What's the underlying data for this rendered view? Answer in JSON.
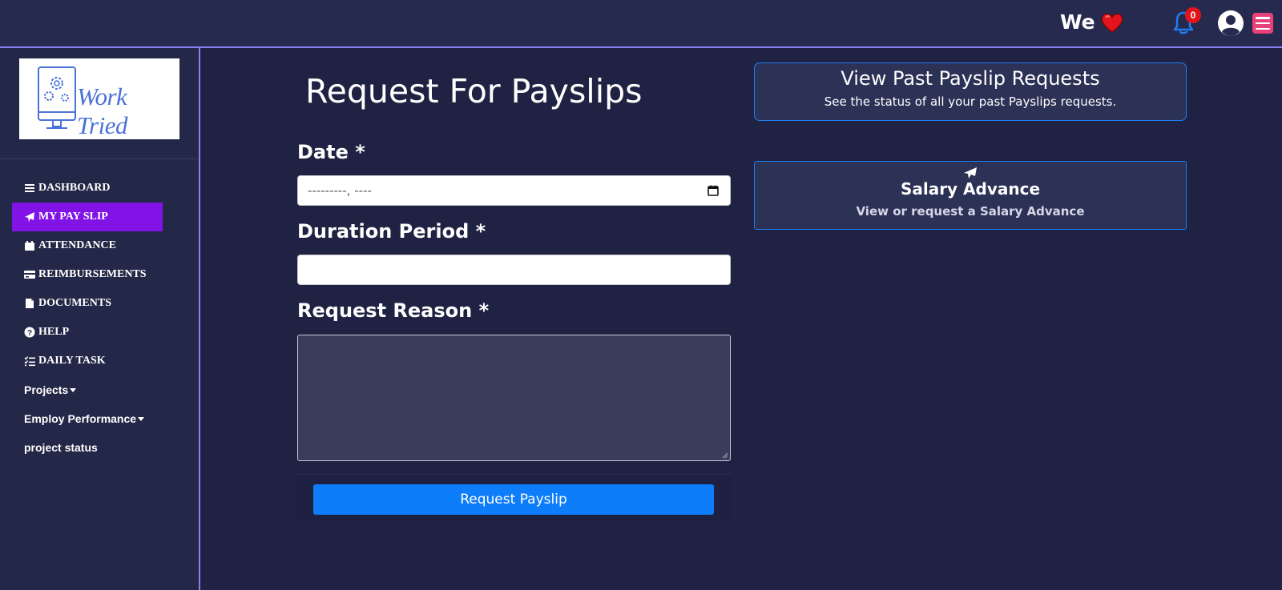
{
  "header": {
    "greeting": "We",
    "notification_count": "0"
  },
  "logo": {
    "text": "Work Tried"
  },
  "sidebar": {
    "items": [
      {
        "label": "DASHBOARD",
        "icon": "bars-icon"
      },
      {
        "label": "MY PAY SLIP",
        "icon": "paper-plane-icon",
        "active": true
      },
      {
        "label": "ATTENDANCE",
        "icon": "calendar-icon"
      },
      {
        "label": "REIMBURSEMENTS",
        "icon": "credit-card-icon"
      },
      {
        "label": "DOCUMENTS",
        "icon": "file-icon"
      },
      {
        "label": "HELP",
        "icon": "question-circle-icon"
      },
      {
        "label": "DAILY TASK",
        "icon": "task-list-icon"
      },
      {
        "label": "Projects",
        "dropdown": true
      },
      {
        "label": "Employ Performance",
        "dropdown": true
      },
      {
        "label": "project status"
      }
    ]
  },
  "form": {
    "title": "Request For Payslips",
    "date_label": "Date *",
    "date_placeholder": "---------, ----",
    "duration_label": "Duration Period *",
    "duration_value": "",
    "reason_label": "Request Reason *",
    "reason_value": "",
    "submit_label": "Request Payslip"
  },
  "cards": {
    "past": {
      "title": "View Past Payslip Requests",
      "subtitle": "See the status of all your past Payslips requests."
    },
    "advance": {
      "title": "Salary Advance",
      "subtitle": "View or request a Salary Advance"
    }
  },
  "colors": {
    "background": "#1f2242",
    "sidebar": "#242848",
    "active_nav": "#8113e6",
    "primary_button": "#0d7dfa",
    "card_border": "#1e7ef5",
    "menu_button": "#e7417c"
  }
}
